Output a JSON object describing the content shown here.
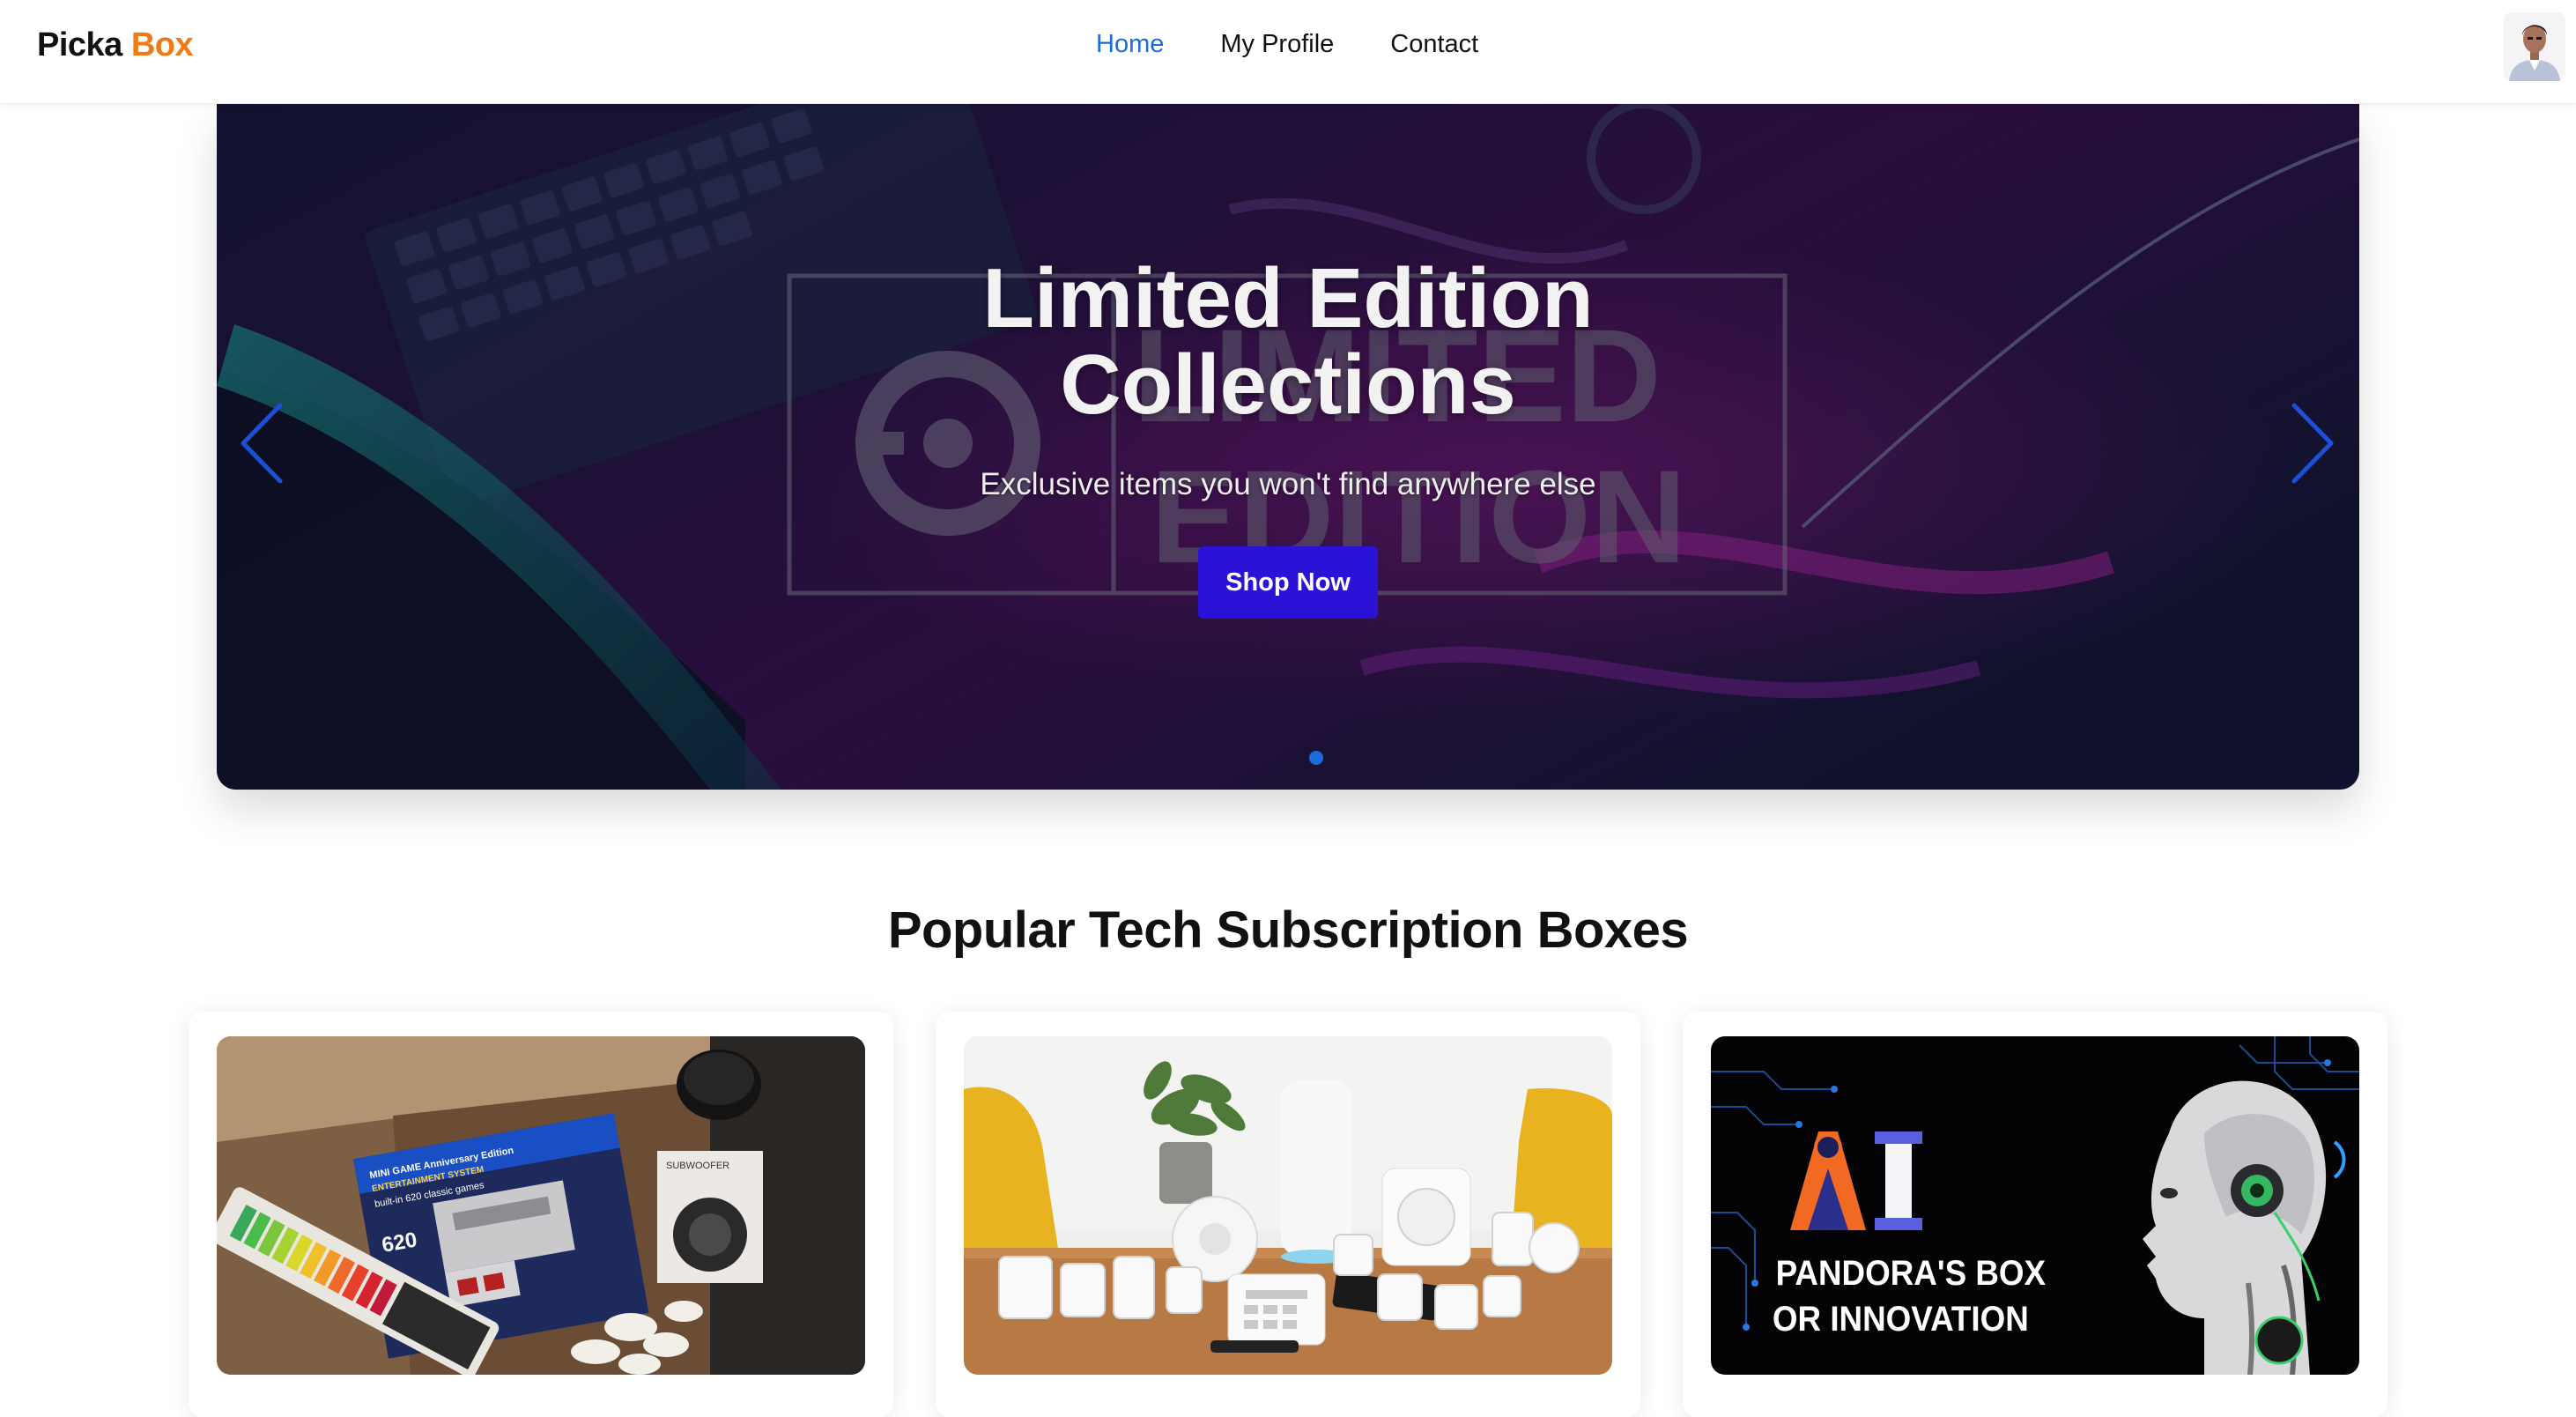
{
  "navbar": {
    "brand_primary": "Picka",
    "brand_accent": "Box",
    "links": [
      {
        "label": "Home",
        "active": true
      },
      {
        "label": "My Profile",
        "active": false
      },
      {
        "label": "Contact",
        "active": false
      }
    ],
    "avatar_icon": "user-avatar"
  },
  "hero": {
    "title_line1": "Limited Edition",
    "title_line2": "Collections",
    "subtitle": "Exclusive items you won't find anywhere else",
    "cta_label": "Shop Now",
    "background_text_line1": "LIMITED",
    "background_text_line2": "EDITION",
    "slide_count": 1,
    "active_slide": 1,
    "prev_icon": "chevron-left-icon",
    "next_icon": "chevron-right-icon"
  },
  "section": {
    "title": "Popular Tech Subscription Boxes"
  },
  "cards": [
    {
      "image": "gadget-box-photo",
      "image_text": {
        "console_line1": "MINI GAME Anniversary Edition",
        "console_line2": "ENTERTAINMENT SYSTEM",
        "console_line3": "built-in 620 classic games",
        "console_line4": "620",
        "speaker": "SUBWOOFER"
      }
    },
    {
      "image": "smart-home-kit-photo"
    },
    {
      "image": "ai-robot-graphic",
      "image_text": {
        "logo": "AI",
        "line1": "PANDORA'S BOX",
        "line2": "OR INNOVATION"
      }
    }
  ],
  "colors": {
    "brand_accent": "#f07b16",
    "nav_active": "#1c6bdd",
    "cta": "#2a13d6"
  }
}
